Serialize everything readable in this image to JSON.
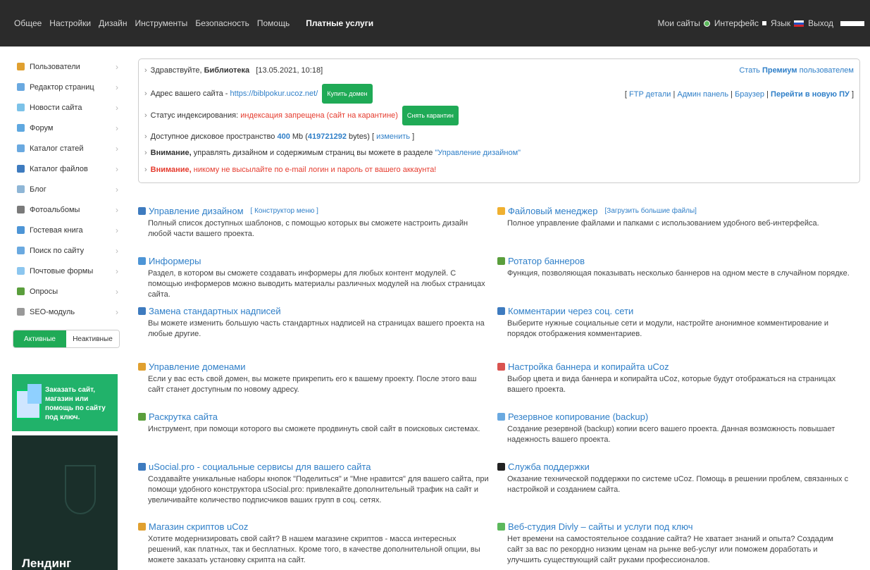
{
  "topnav": {
    "items": [
      "Общее",
      "Настройки",
      "Дизайн",
      "Инструменты",
      "Безопасность",
      "Помощь"
    ],
    "paid": "Платные услуги",
    "my_sites": "Мои сайты",
    "interface": "Интерфейс",
    "language": "Язык",
    "logout": "Выход"
  },
  "sidebar": {
    "items": [
      {
        "label": "Пользователи",
        "icon": "user-icon",
        "color": "#e0a030"
      },
      {
        "label": "Редактор страниц",
        "icon": "page-icon",
        "color": "#6aa9e0"
      },
      {
        "label": "Новости сайта",
        "icon": "news-icon",
        "color": "#7cc2e8"
      },
      {
        "label": "Форум",
        "icon": "forum-icon",
        "color": "#5fa8e0"
      },
      {
        "label": "Каталог статей",
        "icon": "articles-icon",
        "color": "#6aa9e0"
      },
      {
        "label": "Каталог файлов",
        "icon": "files-icon",
        "color": "#3e7bbf"
      },
      {
        "label": "Блог",
        "icon": "blog-icon",
        "color": "#8fb6d6"
      },
      {
        "label": "Фотоальбомы",
        "icon": "photo-icon",
        "color": "#7a7a7a"
      },
      {
        "label": "Гостевая книга",
        "icon": "guestbook-icon",
        "color": "#4d95d6"
      },
      {
        "label": "Поиск по сайту",
        "icon": "search-icon",
        "color": "#6aa9e0"
      },
      {
        "label": "Почтовые формы",
        "icon": "mail-icon",
        "color": "#8cc6ef"
      },
      {
        "label": "Опросы",
        "icon": "poll-icon",
        "color": "#5a9e3c"
      },
      {
        "label": "SEO-модуль",
        "icon": "seo-icon",
        "color": "#999999"
      }
    ],
    "toggle_active": "Активные",
    "toggle_inactive": "Неактивные",
    "promo_text": "Заказать сайт, магазин или помощь по сайту под ключ.",
    "landing_text": "Лендинг"
  },
  "info": {
    "greeting_prefix": "Здравствуйте,",
    "username": "Библиотека",
    "datetime": "[13.05.2021, 10:18]",
    "premium_prefix": "Стать",
    "premium_bold": "Премиум",
    "premium_suffix": "пользователем",
    "site_label": "Адрес вашего сайта -",
    "site_url": "https://biblpokur.ucoz.net/",
    "buy_domain": "Купить домен",
    "links": {
      "open": "[",
      "ftp": "FTP детали",
      "admin": "Админ панель",
      "browser": "Браузер",
      "new_panel": "Перейти в новую ПУ",
      "close": "]",
      "sep": "|"
    },
    "index_label": "Статус индексирования:",
    "index_status": "индексация запрещена (сайт на карантине)",
    "remove_quarantine": "Снять карантин",
    "disk_label": "Доступное дисковое пространство",
    "disk_mb": "400",
    "disk_unit": "Mb (",
    "disk_bytes": "419721292",
    "disk_bytes_suffix": "bytes) [",
    "disk_change": "изменить",
    "disk_close": "]",
    "warn1_bold": "Внимание,",
    "warn1_text": "управлять дизайном и содержимым страниц вы можете в разделе",
    "warn1_link": "\"Управление дизайном\"",
    "warn2_bold": "Внимание,",
    "warn2_text": "никому не высылайте по e-mail логин и пароль от вашего аккаунта!"
  },
  "services": [
    {
      "title": "Управление дизайном",
      "sub": "[ Конструктор меню ]",
      "desc": "Полный список доступных шаблонов, с помощью которых вы сможете настроить дизайн любой части вашего проекта.",
      "icon": "design-icon",
      "color": "#3e7bbf"
    },
    {
      "title": "Файловый менеджер",
      "sub": "[Загрузить большие файлы]",
      "desc": "Полное управление файлами и папками с использованием удобного веб-интерфейса.",
      "icon": "folder-icon",
      "color": "#f0b030"
    },
    {
      "title": "Информеры",
      "sub": "",
      "desc": "Раздел, в котором вы сможете создавать информеры для любых контент модулей. С помощью информеров можно выводить материалы различных модулей на любых страницах сайта.",
      "icon": "informer-icon",
      "color": "#4d95d6"
    },
    {
      "title": "Ротатор баннеров",
      "sub": "",
      "desc": "Функция, позволяющая показывать несколько баннеров на одном месте в случайном порядке.",
      "icon": "banner-icon",
      "color": "#5a9e3c"
    },
    {
      "title": "Замена стандартных надписей",
      "sub": "",
      "desc": "Вы можете изменить большую часть стандартных надписей на страницах вашего проекта на любые другие.",
      "icon": "text-replace-icon",
      "color": "#3e7bbf"
    },
    {
      "title": "Комментарии через соц. сети",
      "sub": "",
      "desc": "Выберите нужные социальные сети и модули, настройте анонимное комментирование и порядок отображения комментариев.",
      "icon": "comments-icon",
      "color": "#3e7bbf"
    },
    {
      "title": "Управление доменами",
      "sub": "",
      "desc": "Если у вас есть свой домен, вы можете прикрепить его к вашему проекту. После этого ваш сайт станет доступным по новому адресу.",
      "icon": "domain-icon",
      "color": "#e0a030"
    },
    {
      "title": "Настройка баннера и копирайта uCoz",
      "sub": "",
      "desc": "Выбор цвета и вида баннера и копирайта uCoz, которые будут отображаться на страницах вашего проекта.",
      "icon": "copyright-icon",
      "color": "#d9534f"
    },
    {
      "title": "Раскрутка сайта",
      "sub": "",
      "desc": "Инструмент, при помощи которого вы сможете продвинуть свой сайт в поисковых системах.",
      "icon": "promotion-icon",
      "color": "#5a9e3c"
    },
    {
      "title": "Резервное копирование (backup)",
      "sub": "",
      "desc": "Создание резервной (backup) копии всего вашего проекта. Данная возможность повышает надежность вашего проекта.",
      "icon": "backup-icon",
      "color": "#6aa9e0"
    },
    {
      "title": "uSocial.pro - социальные сервисы для вашего сайта",
      "sub": "",
      "desc": "Создавайте уникальные наборы кнопок \"Поделиться\" и \"Мне нравится\" для вашего сайта, при помощи удобного конструктора uSocial.pro: привлекайте дополнительный трафик на сайт и увеличивайте количество подписчиков ваших групп в соц. сетях.",
      "icon": "like-icon",
      "color": "#3e7bbf"
    },
    {
      "title": "Служба поддержки",
      "sub": "",
      "desc": "Оказание технической поддержки по системе uCoz. Помощь в решении проблем, связанных с настройкой и созданием сайта.",
      "icon": "help-icon",
      "color": "#222222"
    },
    {
      "title": "Магазин скриптов uCoz",
      "sub": "",
      "desc": "Хотите модернизировать свой сайт? В нашем магазине скриптов - масса интересных решений, как платных, так и бесплатных. Кроме того, в качестве дополнительной опции, вы можете заказать установку скрипта на сайт.",
      "icon": "scripts-icon",
      "color": "#e0a030"
    },
    {
      "title": "Веб-студия Divly – сайты и услуги под ключ",
      "sub": "",
      "desc": "Нет времени на самостоятельное создание сайта? Не хватает знаний и опыта? Создадим сайт за вас по рекордно низким ценам на рынке веб-услуг или поможем доработать и улучшить существующий сайт руками профессионалов.",
      "icon": "studio-icon",
      "color": "#5cb85c"
    }
  ]
}
